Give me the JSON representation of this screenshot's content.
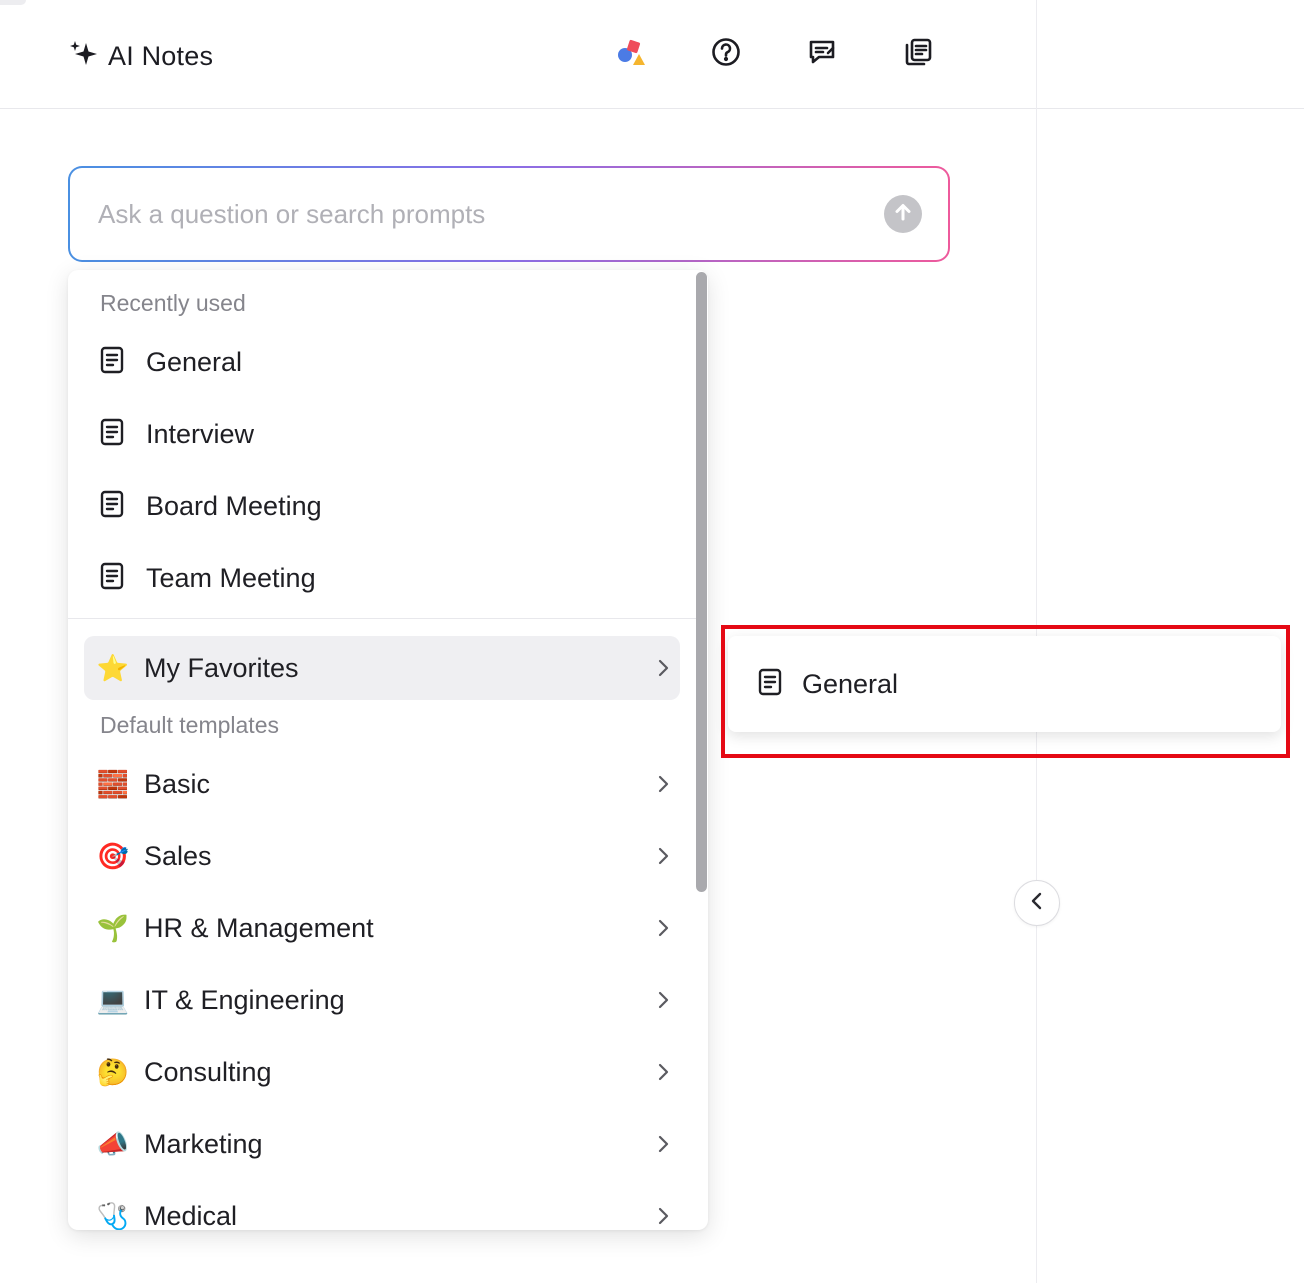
{
  "header": {
    "title": "AI Notes",
    "icons": [
      "sparkle-icon",
      "shapes-icon",
      "help-icon",
      "feedback-icon",
      "notes-copy-icon"
    ]
  },
  "search": {
    "placeholder": "Ask a question or search prompts",
    "value": ""
  },
  "dropdown": {
    "recent_label": "Recently used",
    "recent": [
      {
        "label": "General",
        "icon": "document-icon"
      },
      {
        "label": "Interview",
        "icon": "document-icon"
      },
      {
        "label": "Board Meeting",
        "icon": "document-icon"
      },
      {
        "label": "Team Meeting",
        "icon": "document-icon"
      }
    ],
    "favorites": {
      "label": "My Favorites",
      "icon": "star-icon",
      "emoji": "⭐"
    },
    "default_label": "Default templates",
    "templates": [
      {
        "label": "Basic",
        "emoji": "🧱",
        "icon": "bricks-icon"
      },
      {
        "label": "Sales",
        "emoji": "🎯",
        "icon": "target-icon"
      },
      {
        "label": "HR & Management",
        "emoji": "🌱",
        "icon": "seedling-icon"
      },
      {
        "label": "IT & Engineering",
        "emoji": "💻",
        "icon": "laptop-icon"
      },
      {
        "label": "Consulting",
        "emoji": "🤔",
        "icon": "thinking-face-icon"
      },
      {
        "label": "Marketing",
        "emoji": "📣",
        "icon": "megaphone-icon"
      },
      {
        "label": "Medical",
        "emoji": "🩺",
        "icon": "stethoscope-icon"
      }
    ]
  },
  "submenu": {
    "items": [
      {
        "label": "General",
        "icon": "document-icon"
      }
    ]
  },
  "colors": {
    "gradient_start": "#4a90e2",
    "gradient_end": "#ee5a9c",
    "highlight_box": "#e50914",
    "hover_bg": "#efeff2"
  }
}
